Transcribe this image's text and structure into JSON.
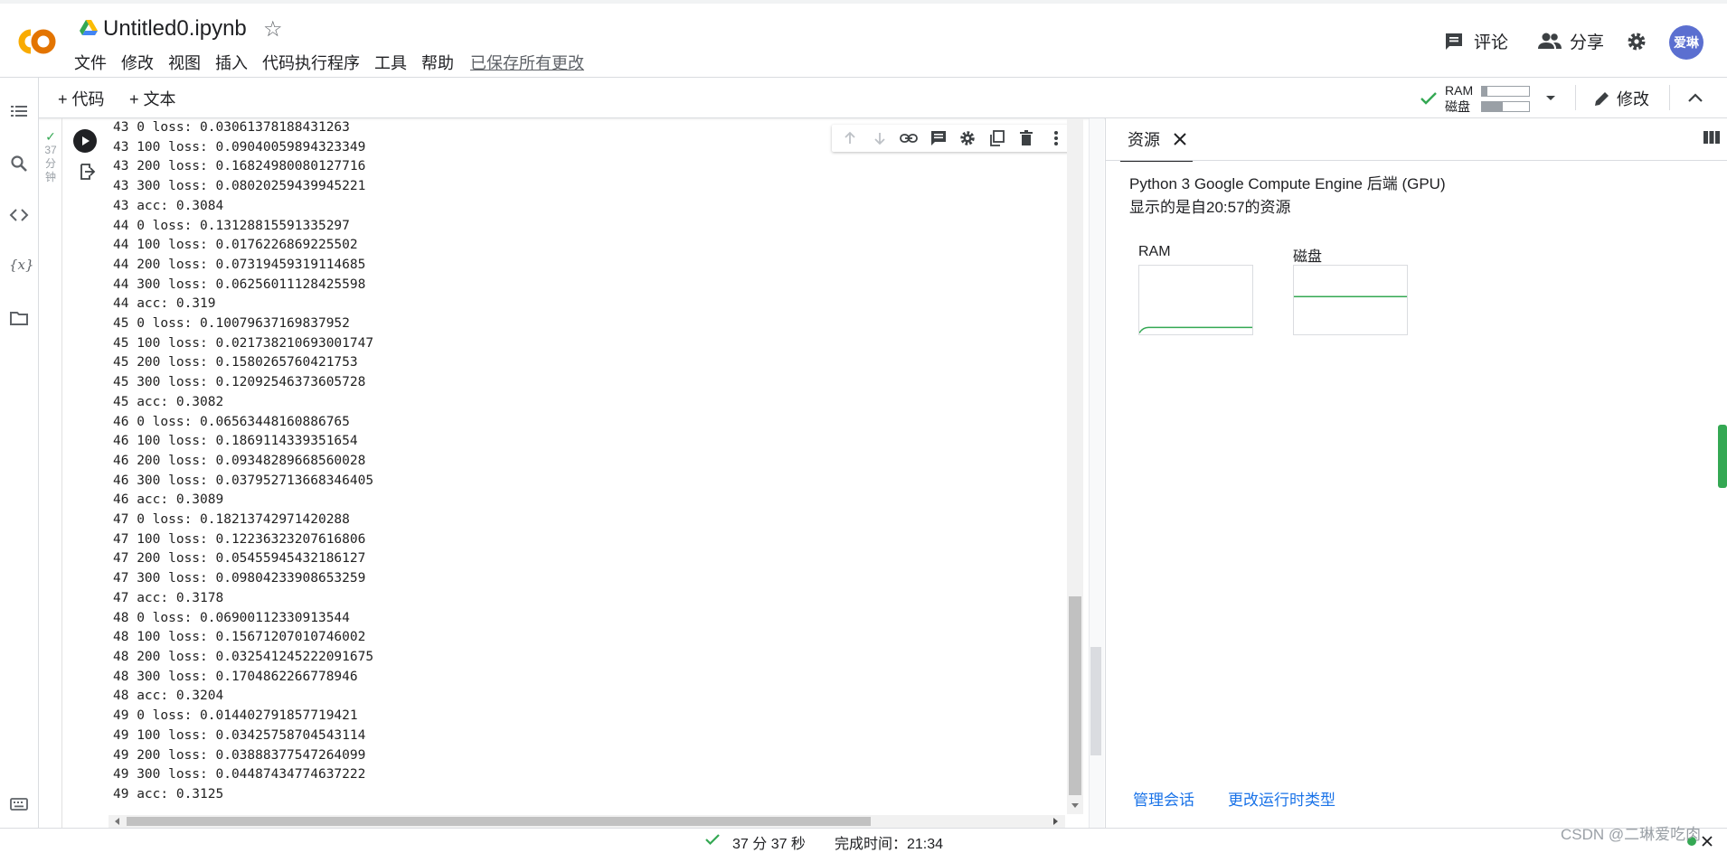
{
  "header": {
    "notebook_title": "Untitled0.ipynb",
    "menus": [
      "文件",
      "修改",
      "视图",
      "插入",
      "代码执行程序",
      "工具",
      "帮助"
    ],
    "saved_status": "已保存所有更改",
    "comment_label": "评论",
    "share_label": "分享",
    "avatar_text": "爱琳"
  },
  "toolbar": {
    "add_code": "+ 代码",
    "add_text": "+ 文本",
    "ram_label": "RAM",
    "disk_label": "磁盘",
    "ram_fill": 0.12,
    "disk_fill": 0.45,
    "edit_label": "修改"
  },
  "cell": {
    "exec_time_line1": "37",
    "exec_time_line2": "分",
    "exec_time_line3": "钟",
    "output_lines": [
      "43 0 loss: 0.03061378188431263",
      "43 100 loss: 0.09040059894323349",
      "43 200 loss: 0.16824980080127716",
      "43 300 loss: 0.08020259439945221",
      "43 acc: 0.3084",
      "44 0 loss: 0.13128815591335297",
      "44 100 loss: 0.0176226869225502",
      "44 200 loss: 0.07319459319114685",
      "44 300 loss: 0.06256011128425598",
      "44 acc: 0.319",
      "45 0 loss: 0.10079637169837952",
      "45 100 loss: 0.021738210693001747",
      "45 200 loss: 0.1580265760421753",
      "45 300 loss: 0.12092546373605728",
      "45 acc: 0.3082",
      "46 0 loss: 0.06563448160886765",
      "46 100 loss: 0.1869114339351654",
      "46 200 loss: 0.09348289668560028",
      "46 300 loss: 0.037952713668346405",
      "46 acc: 0.3089",
      "47 0 loss: 0.18213742971420288",
      "47 100 loss: 0.12236323207616806",
      "47 200 loss: 0.05455945432186127",
      "47 300 loss: 0.09804233908653259",
      "47 acc: 0.3178",
      "48 0 loss: 0.06900112330913544",
      "48 100 loss: 0.15671207010746002",
      "48 200 loss: 0.032541245222091675",
      "48 300 loss: 0.1704862266778946",
      "48 acc: 0.3204",
      "49 0 loss: 0.014402791857719421",
      "49 100 loss: 0.03425758704543114",
      "49 200 loss: 0.03888377547264099",
      "49 300 loss: 0.04487434774637222",
      "49 acc: 0.3125"
    ]
  },
  "panel": {
    "tab_label": "资源",
    "backend": "Python 3 Google Compute Engine 后端 (GPU)",
    "since": "显示的是自20:57的资源",
    "ram_graph_label": "RAM",
    "disk_graph_label": "磁盘",
    "ram_level": 0.1,
    "disk_level": 0.55,
    "manage_sessions": "管理会话",
    "change_runtime": "更改运行时类型"
  },
  "status": {
    "duration": "37 分 37 秒",
    "completed": "完成时间：21:34"
  },
  "watermark": "CSDN @二琳爱吃肉",
  "colors": {
    "accent_green": "#34a853",
    "link_blue": "#1a73e8",
    "avatar_bg": "#5b6fd0",
    "logo_orange": "#f9ab00"
  }
}
